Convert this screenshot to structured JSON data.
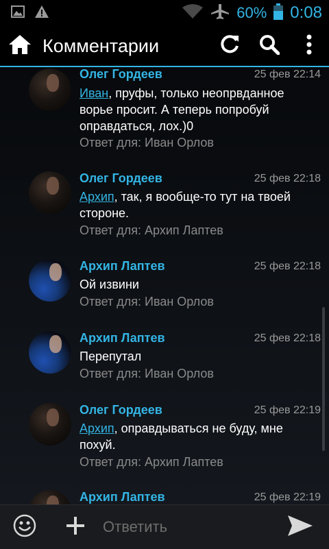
{
  "status_bar": {
    "battery": "60%",
    "time": "0:08"
  },
  "action_bar": {
    "title": "Комментарии"
  },
  "comments": [
    {
      "author": "Олег Гордеев",
      "date": "25 фев 22:14",
      "mention": "Иван",
      "text": ", пруфы, только неопрвданное ворье просит. А теперь попробуй оправдаться, лох.)0",
      "reply": "Ответ для: Иван Орлов"
    },
    {
      "author": "Олег Гордеев",
      "date": "25 фев 22:18",
      "mention": "Архип",
      "text": ", так, я вообще-то тут на твоей стороне.",
      "reply": "Ответ для: Архип Лаптев"
    },
    {
      "author": "Архип Лаптев",
      "date": "25 фев 22:18",
      "mention": "",
      "text": "Ой извини",
      "reply": "Ответ для: Иван Орлов"
    },
    {
      "author": "Архип Лаптев",
      "date": "25 фев 22:18",
      "mention": "",
      "text": "Перепутал",
      "reply": "Ответ для: Иван Орлов"
    },
    {
      "author": "Олег Гордеев",
      "date": "25 фев 22:19",
      "mention": "Архип",
      "text": ", оправдываться не буду, мне похуй.",
      "reply": "Ответ для: Архип Лаптев"
    },
    {
      "author": "Архип Лаптев",
      "date": "25 фев 22:19",
      "mention": "",
      "text": "",
      "reply": ""
    }
  ],
  "compose": {
    "placeholder": "Ответить"
  },
  "colors": {
    "accent": "#33b5e5",
    "background": "#000000"
  }
}
